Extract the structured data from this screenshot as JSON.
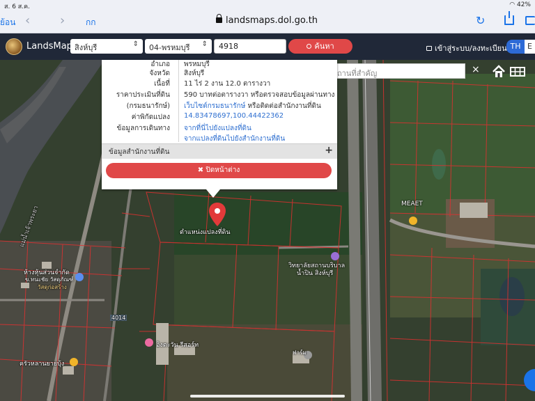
{
  "status_bar": {
    "time": "ส. 6 ส.ค.",
    "battery": "42%"
  },
  "browser": {
    "back_label": "ย้อน",
    "text_size_label": "กก",
    "url": "landsmaps.dol.go.th",
    "nav_back_icon": "chevron-left-icon",
    "nav_forward_icon": "chevron-right-icon",
    "reload_icon": "reload-icon",
    "share_icon": "share-icon",
    "tabs_icon": "tabs-icon"
  },
  "header": {
    "brand": "LandsMaps",
    "province": "สิงห์บุรี",
    "district": "04-พรหมบุรี",
    "parcel_number": "4918",
    "search_label": "ค้นหา",
    "login_label": "เข้าสู่ระบบ/ลงทะเบียน",
    "lang_th": "TH",
    "lang_en": "E",
    "accent_color": "#e04848",
    "header_bg": "#202838"
  },
  "map_search": {
    "placeholder": "ค้นหาสถานที่สำคัญ",
    "clear": "×"
  },
  "popup": {
    "rows": [
      {
        "key": "อำเภอ",
        "value": "พรหมบุรี"
      },
      {
        "key": "จังหวัด",
        "value": "สิงห์บุรี"
      },
      {
        "key": "เนื้อที่",
        "value": "11 ไร่ 2 งาน 12.0 ตารางวา"
      },
      {
        "key": "ราคาประเมินที่ดิน",
        "value": "590 บาทต่อตารางวา หรือตรวจสอบข้อมูลผ่านทาง"
      },
      {
        "key": "(กรมธนารักษ์)",
        "value": "เว็บไซต์กรมธนารักษ์",
        "value2": "หรือติดต่อสำนักงานที่ดิน"
      },
      {
        "key": "ค่าพิกัดแปลง",
        "value": "14.83478697,100.44422362"
      },
      {
        "key": "ข้อมูลการเดินทาง",
        "value": "จากที่นี่ไปยังแปลงที่ดิน"
      },
      {
        "key": "",
        "value": "จากแปลงที่ดินไปยังสำนักงานที่ดิน"
      }
    ],
    "office_label": "ข้อมูลสำนักงานที่ดิน",
    "office_toggle": "+",
    "close_label": "ปิดหน้าต่าง",
    "close_icon": "✖"
  },
  "map_labels": {
    "parcel_caption": "ตำแหน่งแปลงที่ดิน",
    "meaet": "MEAET",
    "shop": "ห้างหุ้นส่วนจำกัด",
    "shop2": "ข.ทนะชัย วัสดุภัณฑ์",
    "shop3": "วัสดุก่อสร้าง",
    "college": "วิทยาลัยสถานบริบาล",
    "college2": "น้ำปิน สิงห์บุรี",
    "resort": "อิงตะวัน รีสอร์ท",
    "shop4": "ครัวหลานยายบุ้ง",
    "road": "4014",
    "river": "แม่น้ำเจ้าพระยา",
    "extra": "ฟาร์ม"
  }
}
